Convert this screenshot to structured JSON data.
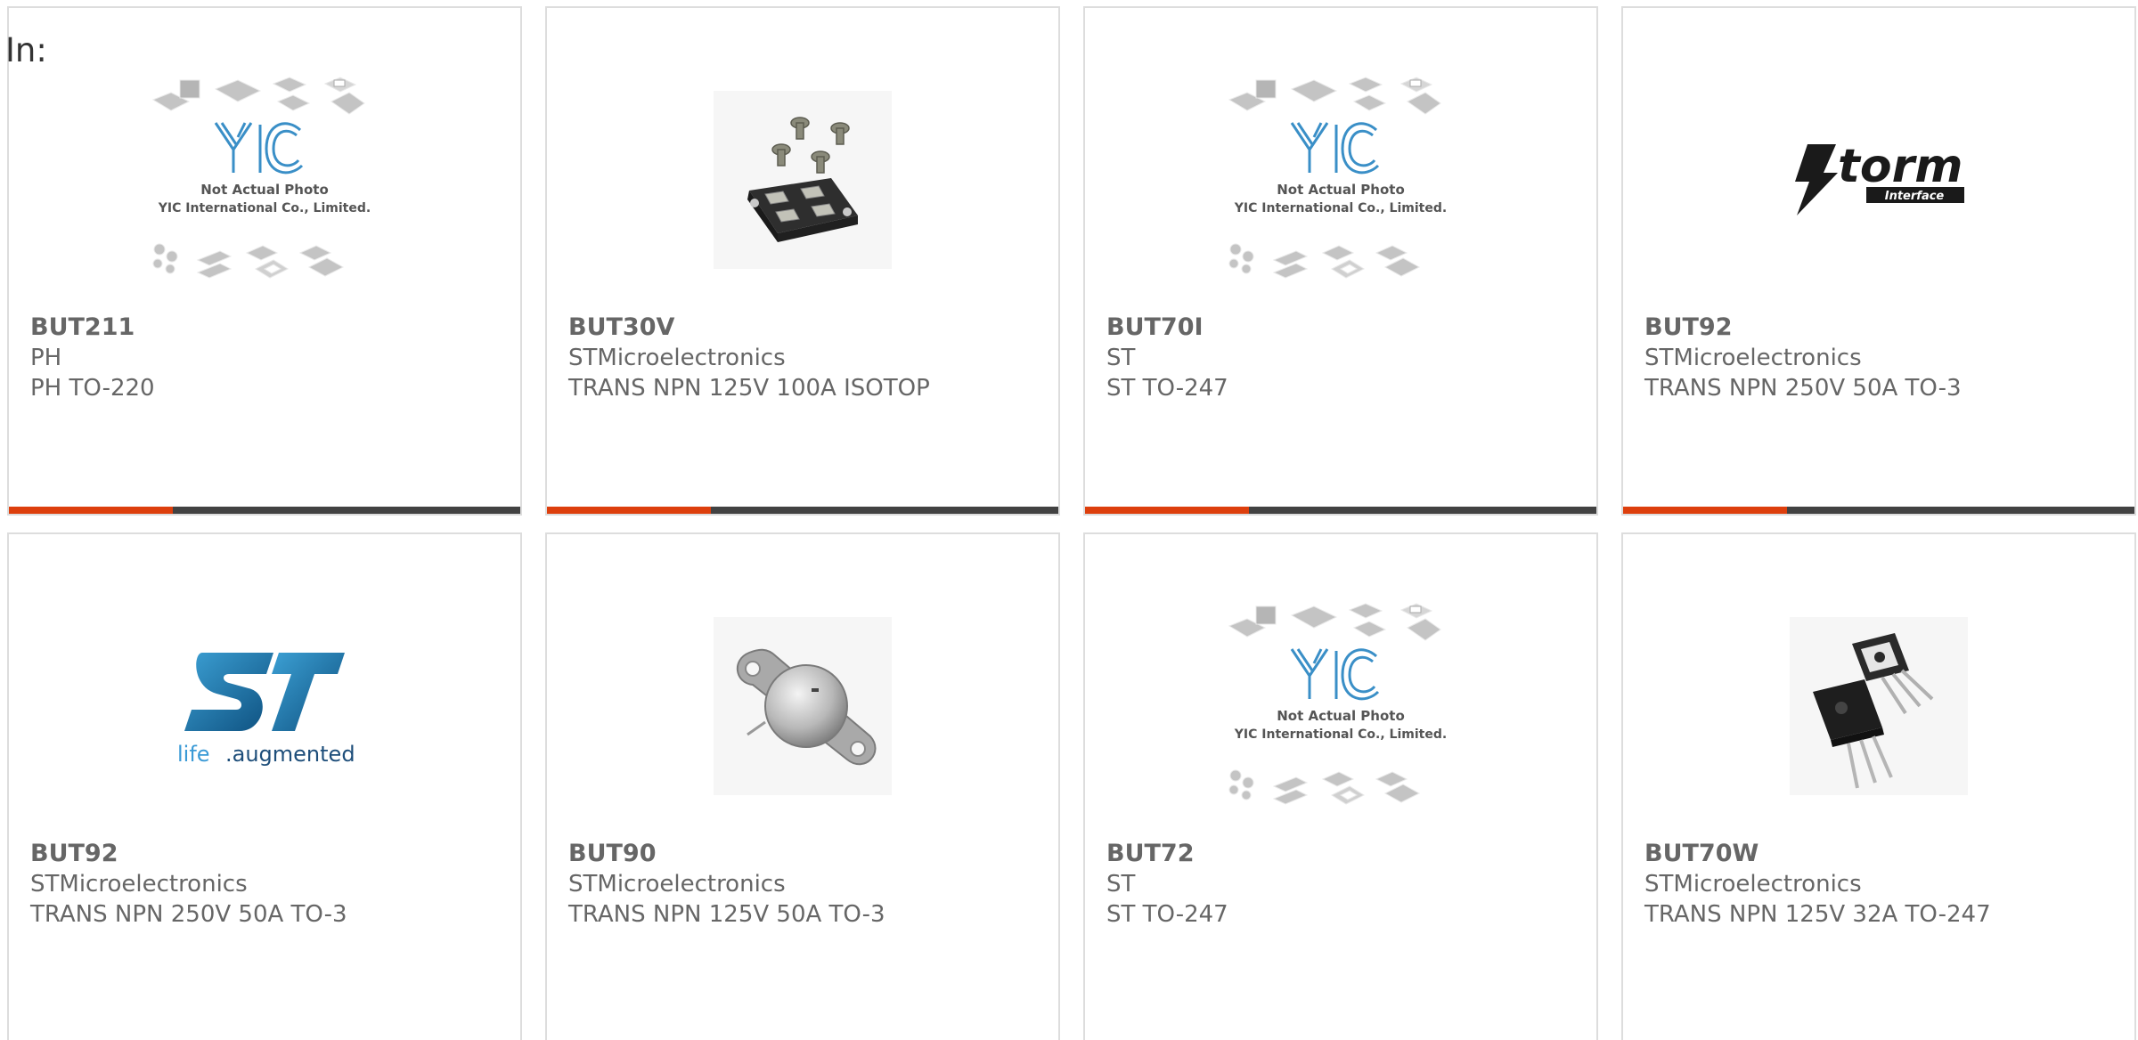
{
  "page": {
    "heading": "In:"
  },
  "colors": {
    "accent": "#dd3f0d",
    "bar": "#424242",
    "border": "#dddddd",
    "text": "#666666"
  },
  "placeholder_image": {
    "line1": "Not Actual Photo",
    "line2": "YIC International Co., Limited."
  },
  "logos": {
    "storm": {
      "main": "torm",
      "sub": "Interface"
    },
    "st": {
      "tagline_a": "life",
      "tagline_b": ".augmented"
    }
  },
  "products": [
    {
      "part": "BUT211",
      "manufacturer": "PH",
      "description": "PH TO-220",
      "image": "yic-placeholder"
    },
    {
      "part": "BUT30V",
      "manufacturer": "STMicroelectronics",
      "description": "TRANS NPN 125V 100A ISOTOP",
      "image": "isotop-module"
    },
    {
      "part": "BUT70I",
      "manufacturer": "ST",
      "description": "ST TO-247",
      "image": "yic-placeholder"
    },
    {
      "part": "BUT92",
      "manufacturer": "STMicroelectronics",
      "description": "TRANS NPN 250V 50A TO-3",
      "image": "storm-interface-logo"
    },
    {
      "part": "BUT92",
      "manufacturer": "STMicroelectronics",
      "description": "TRANS NPN 250V 50A TO-3",
      "image": "st-logo"
    },
    {
      "part": "BUT90",
      "manufacturer": "STMicroelectronics",
      "description": "TRANS NPN 125V 50A TO-3",
      "image": "to3-can"
    },
    {
      "part": "BUT72",
      "manufacturer": "ST",
      "description": "ST TO-247",
      "image": "yic-placeholder"
    },
    {
      "part": "BUT70W",
      "manufacturer": "STMicroelectronics",
      "description": "TRANS NPN 125V 32A TO-247",
      "image": "to247-transistors"
    }
  ]
}
